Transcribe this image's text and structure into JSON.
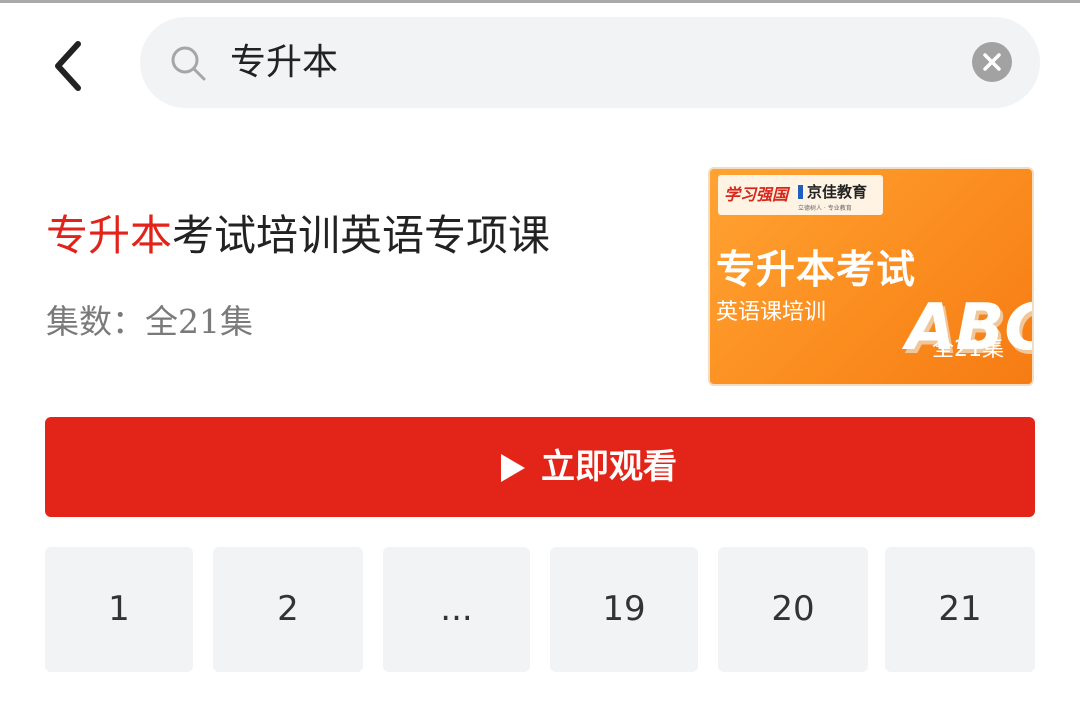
{
  "search": {
    "query": "专升本"
  },
  "result": {
    "title_highlight": "专升本",
    "title_rest": "考试培训英语专项课",
    "episode_count": "集数：全21集",
    "thumbnail": {
      "brand_a": "学习强国",
      "brand_b": "京佳教育",
      "brand_tagline": "立德树人 · 专业教育",
      "headline": "专升本考试",
      "subheadline": "英语课培训",
      "big_text": "ABC",
      "episodes": "全21集"
    }
  },
  "watch_button": {
    "label": "立即观看"
  },
  "episodes": [
    "1",
    "2",
    "...",
    "19",
    "20",
    "21"
  ],
  "colors": {
    "accent": "#e32419",
    "chip_bg": "#f2f3f5",
    "thumbnail_orange": "#fb8d1f"
  },
  "icons": [
    "back-arrow-icon",
    "search-icon",
    "clear-icon",
    "play-icon"
  ]
}
